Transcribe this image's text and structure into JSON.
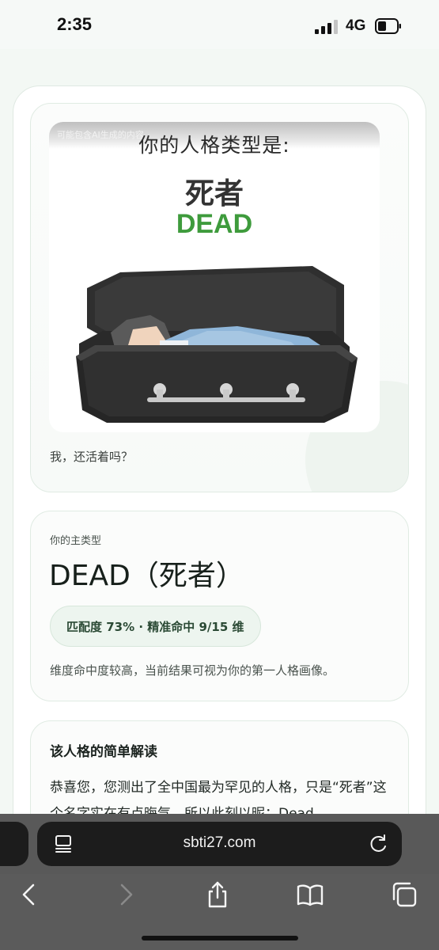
{
  "status_bar": {
    "time": "2:35",
    "network": "4G"
  },
  "result_image": {
    "watermark": "可能包含AI生成的内容",
    "title": "你的人格类型是:",
    "type_cn": "死者",
    "type_en": "DEAD"
  },
  "hero_card": {
    "tagline": "我，还活着吗？"
  },
  "type_card": {
    "label": "你的主类型",
    "name": "DEAD（死者）",
    "match_text": "匹配度 73% · 精准命中 9/15 维",
    "note": "维度命中度较高，当前结果可视为你的第一人格画像。"
  },
  "reading_card": {
    "title": "该人格的简单解读",
    "body": "恭喜您，您测出了全中国最为罕见的人格，只是“死者”这个名字实在有点晦气，所以此刻以昵：Dead"
  },
  "browser": {
    "url": "sbti27.com"
  },
  "colors": {
    "accent_green": "#3e9b3c",
    "pill_bg": "#edf5ef",
    "browser_bar": "#1c1c1c"
  }
}
